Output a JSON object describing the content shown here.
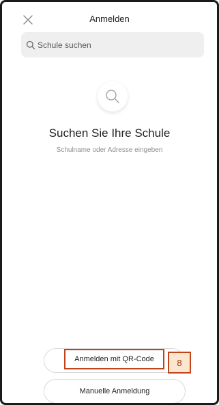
{
  "header": {
    "title": "Anmelden",
    "close_icon": "close-icon"
  },
  "search": {
    "placeholder": "Schule suchen",
    "icon": "search-icon"
  },
  "empty_state": {
    "icon": "search-icon",
    "heading": "Suchen Sie Ihre Schule",
    "subtext": "Schulname oder Adresse eingeben"
  },
  "actions": {
    "qr_login_label": "Anmelden mit QR-Code",
    "manual_login_label": "Manuelle Anmeldung"
  },
  "annotation": {
    "badge_number": "8",
    "accent_color": "#c0451b",
    "badge_fill": "#fde6d0"
  }
}
